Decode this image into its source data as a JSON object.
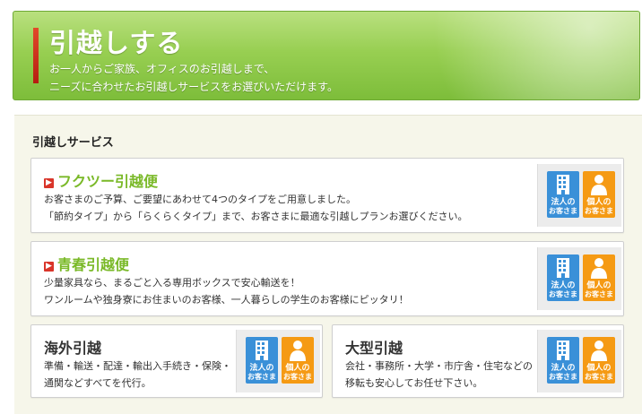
{
  "hero": {
    "title": "引越しする",
    "desc_line1": "お一人からご家族、オフィスのお引越しまで、",
    "desc_line2": "ニーズに合わせたお引越しサービスをお選びいただけます。"
  },
  "section_title": "引越しサービス",
  "badges": {
    "corp_line1": "法人の",
    "corp_line2": "お客さま",
    "indiv_line1": "個人の",
    "indiv_line2": "お客さま"
  },
  "cards": [
    {
      "title": "フクツー引越便",
      "line1": "お客さまのご予算、ご要望にあわせて4つのタイプをご用意しました。",
      "line2": "「節約タイプ」から「らくらくタイプ」まで、お客さまに最適な引越しプランお選びください。"
    },
    {
      "title": "青春引越便",
      "line1": "少量家具なら、まるごと入る専用ボックスで安心輸送を！",
      "line2": "ワンルームや独身寮にお住まいのお客様、一人暮らしの学生のお客様にピッタリ！"
    },
    {
      "title": "海外引越",
      "line1": "準備・輸送・配達・輸出入手続き・保険・",
      "line2": "通関などすべてを代行。"
    },
    {
      "title": "大型引越",
      "line1": "会社・事務所・大学・市庁舎・住宅などの",
      "line2": "移転も安心してお任せ下さい。"
    }
  ],
  "colors": {
    "hero_green": "#98cf52",
    "title_green": "#7ab928",
    "corp_blue": "#3a90d8",
    "indiv_orange": "#f59a14",
    "accent_red": "#d9352a"
  }
}
